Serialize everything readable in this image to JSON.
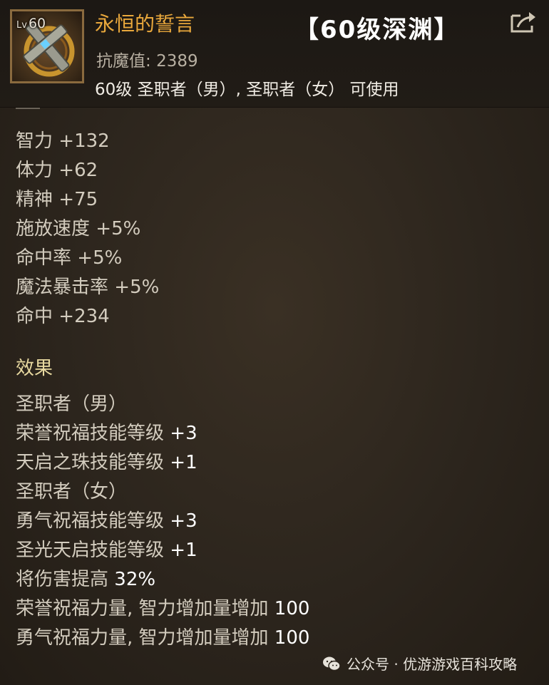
{
  "item": {
    "level_prefix": "Lv",
    "level": "60",
    "name": "永恒的誓言",
    "banner": "【60级深渊】",
    "resist_label": "抗魔值:",
    "resist_value": "2389",
    "usable_by": "60级 圣职者（男）, 圣职者（女） 可使用"
  },
  "stats": [
    {
      "name": "智力",
      "value": "+132"
    },
    {
      "name": "体力",
      "value": "+62"
    },
    {
      "name": "精神",
      "value": "+75"
    },
    {
      "name": "施放速度",
      "value": "+5%"
    },
    {
      "name": "命中率",
      "value": "+5%"
    },
    {
      "name": "魔法暴击率",
      "value": "+5%"
    },
    {
      "name": "命中",
      "value": "+234"
    }
  ],
  "effects_title": "效果",
  "effects": [
    {
      "text": "圣职者（男）",
      "value": ""
    },
    {
      "text": "荣誉祝福技能等级",
      "value": "+3"
    },
    {
      "text": "天启之珠技能等级",
      "value": "+1"
    },
    {
      "text": "圣职者（女）",
      "value": ""
    },
    {
      "text": "勇气祝福技能等级",
      "value": "+3"
    },
    {
      "text": "圣光天启技能等级",
      "value": "+1"
    },
    {
      "text": "将伤害提高",
      "value": "32%"
    },
    {
      "text": "荣誉祝福力量, 智力增加量增加",
      "value": "100"
    },
    {
      "text": "勇气祝福力量, 智力增加量增加",
      "value": "100"
    }
  ],
  "watermark": "公众号 · 优游游戏百科攻略",
  "colors": {
    "item_name": "#e9a83c",
    "section_title": "#e8d9a0",
    "frame": "#8a6a3e"
  },
  "icons": [
    "item-icon-cross",
    "export-icon",
    "wechat-icon"
  ]
}
